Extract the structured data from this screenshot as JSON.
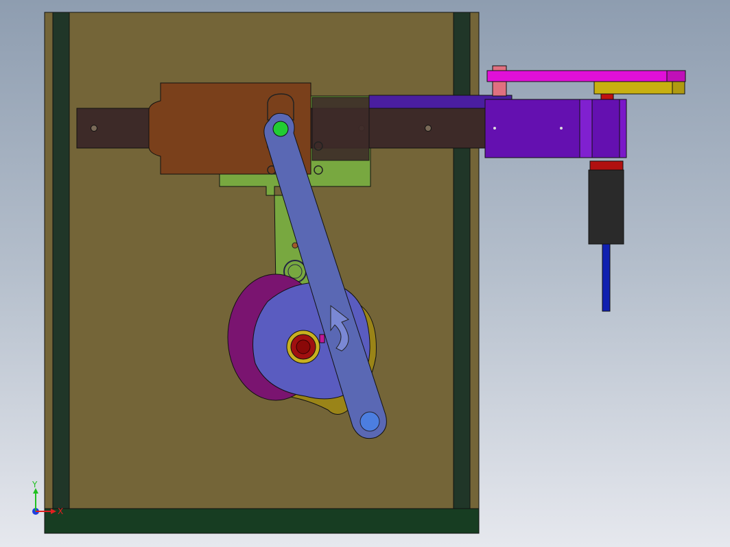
{
  "viewport": {
    "background_top": "#8e9db0",
    "background_bottom": "#e6e8ee"
  },
  "triad": {
    "x_label": "X",
    "y_label": "Y",
    "x_color": "#e02020",
    "y_color": "#20c020",
    "z_color": "#2040e0"
  },
  "colors": {
    "base_plate": "#746538",
    "side_rail": "#203628",
    "bottom_rail": "#173d22",
    "slide_bar": "#3d2a28",
    "slider_block": "#7a401b",
    "green_bracket": "#78a840",
    "crank_arm": "#5a68b4",
    "cam_disc": "#5a5cc0",
    "magenta_disc": "#7a1470",
    "yellow_cam": "#9a8418",
    "hub_red": "#a01010",
    "hub_ring": "#c8b020",
    "motor_housing": "#6410b0",
    "pink_bar": "#e010d8",
    "yellow_bar": "#c8b010",
    "motor_body": "#2a2a2a",
    "shaft_blue": "#1020b0"
  }
}
